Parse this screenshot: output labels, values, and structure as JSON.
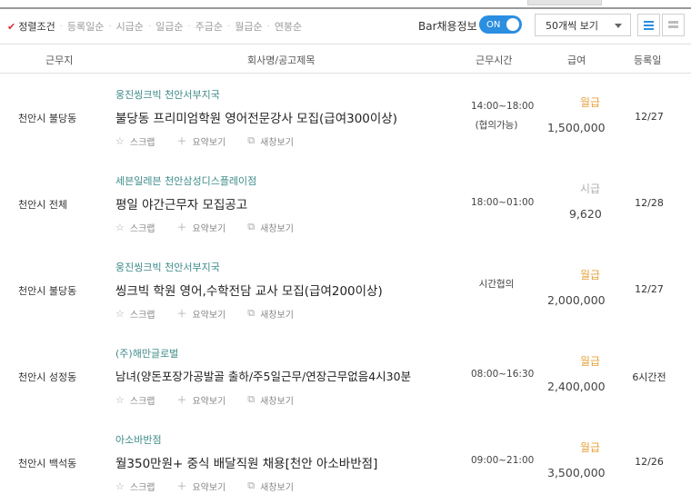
{
  "sort": {
    "items": [
      "정렬조건",
      "등록일순",
      "시급순",
      "일급순",
      "주급순",
      "월급순",
      "연봉순"
    ]
  },
  "bar_label": "Bar채용정보",
  "toggle_label": "ON",
  "select_value": "50개씩 보기",
  "colors": {
    "accent": "#2b8ee0",
    "company": "#3d8b8a",
    "pay_monthly": "#e6a23c",
    "pay_hourly": "#b0b0b0",
    "check": "#d9303b"
  },
  "columns": {
    "location": "근무지",
    "company_title": "회사명/공고제목",
    "hours": "근무시간",
    "pay": "급여",
    "registered": "등록일"
  },
  "action_labels": {
    "scrap": "스크랩",
    "summary": "요약보기",
    "new_window": "새창보기"
  },
  "jobs": [
    {
      "location": "천안시 불당동",
      "company": "웅진씽크빅 천안서부지국",
      "title": "불당동 프리미엄학원 영어전문강사 모집(급여300이상)",
      "hours": [
        "14:00~18:00",
        "(협의가능)"
      ],
      "pay_type": "월급",
      "pay_amount": "1,500,000",
      "registered": "12/27"
    },
    {
      "location": "천안시 전체",
      "company": "세븐일레븐 천안삼성디스플레이점",
      "title": "평일 야간근무자 모집공고",
      "hours": [
        "18:00~01:00"
      ],
      "pay_type": "시급",
      "pay_amount": "9,620",
      "registered": "12/28"
    },
    {
      "location": "천안시 불당동",
      "company": "웅진씽크빅 천안서부지국",
      "title": "씽크빅 학원 영어,수학전담 교사 모집(급여200이상)",
      "hours": [
        "시간협의"
      ],
      "pay_type": "월급",
      "pay_amount": "2,000,000",
      "registered": "12/27"
    },
    {
      "location": "천안시 성정동",
      "company": "(주)해만글로벌",
      "title": "남녀(양돈포장가공발골 출하/주5일근무/연장근무없음4시30분",
      "hours": [
        "08:00~16:30"
      ],
      "pay_type": "월급",
      "pay_amount": "2,400,000",
      "registered": "6시간전"
    },
    {
      "location": "천안시 백석동",
      "company": "아소바반점",
      "title": "월350만원+ 중식 배달직원 채용[천안 아소바반점]",
      "hours": [
        "09:00~21:00"
      ],
      "pay_type": "월급",
      "pay_amount": "3,500,000",
      "registered": "12/26"
    }
  ]
}
